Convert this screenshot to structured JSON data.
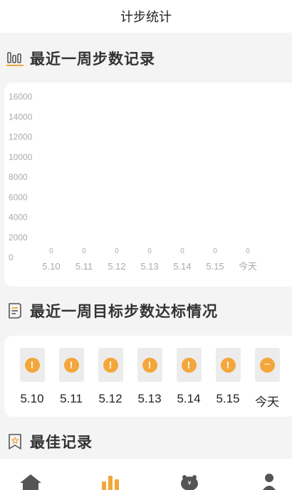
{
  "header": {
    "title": "计步统计"
  },
  "sections": {
    "weekly_steps": "最近一周步数记录",
    "weekly_goals": "最近一周目标步数达标情况",
    "best_records": "最佳记录"
  },
  "chart_data": {
    "type": "bar",
    "categories": [
      "5.10",
      "5.11",
      "5.12",
      "5.13",
      "5.14",
      "5.15",
      "今天"
    ],
    "values": [
      0,
      0,
      0,
      0,
      0,
      0,
      0
    ],
    "value_labels": [
      "0",
      "0",
      "0",
      "0",
      "0",
      "0",
      "0"
    ],
    "yticks": [
      "16000",
      "14000",
      "12000",
      "10000",
      "8000",
      "6000",
      "4000",
      "2000",
      "0"
    ],
    "ylim": [
      0,
      16000
    ],
    "grid": false
  },
  "goals": [
    {
      "label": "5.10",
      "icon": "!",
      "status": "warning"
    },
    {
      "label": "5.11",
      "icon": "!",
      "status": "warning"
    },
    {
      "label": "5.12",
      "icon": "!",
      "status": "warning"
    },
    {
      "label": "5.13",
      "icon": "!",
      "status": "warning"
    },
    {
      "label": "5.14",
      "icon": "!",
      "status": "warning"
    },
    {
      "label": "5.15",
      "icon": "!",
      "status": "warning"
    },
    {
      "label": "今天",
      "icon": "···",
      "status": "pending"
    }
  ],
  "colors": {
    "accent": "#f3a63a",
    "tab_inactive": "#555555",
    "tick": "#aaaaaa"
  },
  "tabbar_icons": [
    "home-icon",
    "stats-icon",
    "piggy-bank-icon",
    "profile-icon"
  ]
}
